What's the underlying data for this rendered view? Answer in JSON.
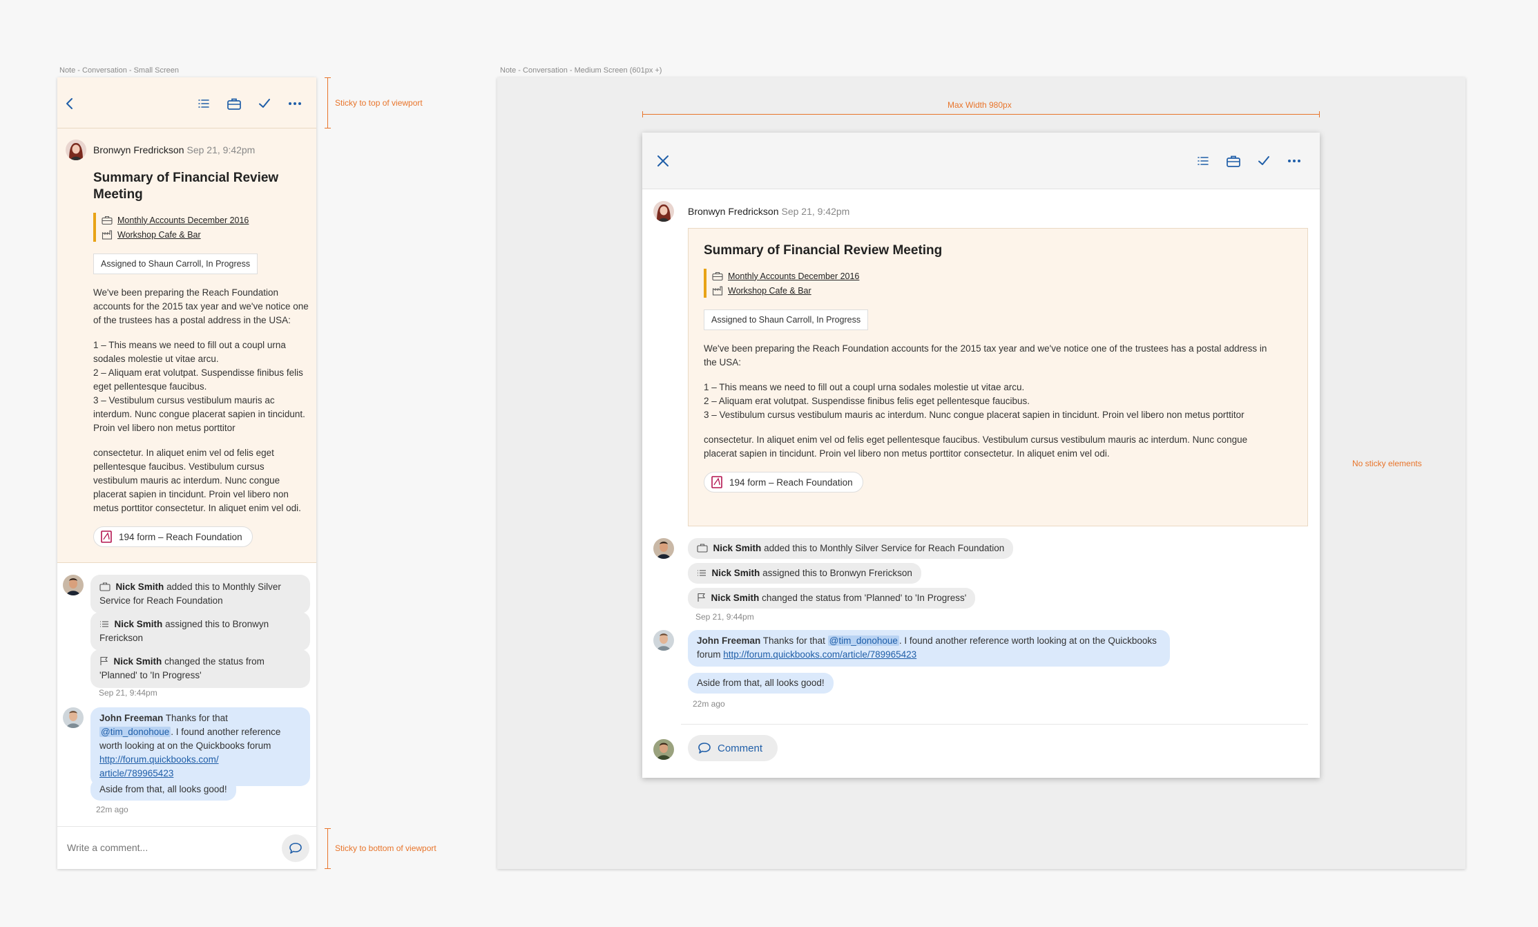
{
  "captions": {
    "small": "Note - Conversation - Small Screen",
    "medium": "Note - Conversation - Medium Screen (601px +)"
  },
  "annotations": {
    "sticky_top": "Sticky to top of viewport",
    "sticky_bottom": "Sticky to bottom of viewport",
    "max_width": "Max Width 980px",
    "no_sticky": "No sticky elements"
  },
  "colors": {
    "accent": "#1f5ea8",
    "note_bg": "#fdf4ea",
    "link_bar": "#e8a317",
    "annotation": "#e8742a",
    "pdf_icon": "#b3134f"
  },
  "toolbar_icons": [
    "back-icon",
    "checklist-icon",
    "briefcase-icon",
    "check-icon",
    "more-icon",
    "close-icon"
  ],
  "note": {
    "author": "Bronwyn Fredrickson",
    "date": "Sep 21, 9:42pm",
    "title": "Summary of Financial Review Meeting",
    "links": [
      {
        "icon": "briefcase-icon",
        "label": "Monthly Accounts December 2016"
      },
      {
        "icon": "store-icon",
        "label": "Workshop Cafe & Bar"
      }
    ],
    "assigned": "Assigned to Shaun Carroll, In Progress",
    "paragraph1": "We've been preparing the Reach Foundation accounts for the 2015 tax year and we've notice one of the trustees has a postal address in the USA:",
    "list": [
      "1 – This means we need to fill out a coupl urna sodales molestie ut vitae arcu.",
      "2 –  Aliquam erat volutpat. Suspendisse finibus felis eget pellentesque faucibus.",
      "3 – Vestibulum cursus vestibulum mauris ac interdum. Nunc congue placerat sapien in tincidunt. Proin vel libero non metus porttitor"
    ],
    "paragraph2": "consectetur. In aliquet enim vel od felis eget pellentesque faucibus. Vestibulum cursus vestibulum mauris ac interdum. Nunc congue placerat sapien in tincidunt. Proin vel libero non metus porttitor consectetur. In aliquet enim vel odi.",
    "attachment": "194 form – Reach Foundation"
  },
  "activity": {
    "actor": "Nick Smith",
    "items": [
      {
        "icon": "briefcase-icon",
        "text": "added this to Monthly Silver Service for Reach Foundation"
      },
      {
        "icon": "checklist-icon",
        "text": "assigned this to Bronwyn Frerickson"
      },
      {
        "icon": "flag-icon",
        "text": "changed the status from 'Planned' to 'In Progress'"
      }
    ],
    "time": "Sep 21, 9:44pm"
  },
  "comment": {
    "author": "John Freeman",
    "pre": "Thanks for that",
    "mention": "@tim_donohoue",
    "post": ". I found another reference worth looking at on the Quickbooks forum",
    "link_small_1": "http://forum.quickbooks.com/",
    "link_small_2": "article/789965423",
    "link": "http://forum.quickbooks.com/article/789965423",
    "followup": "Aside from that, all looks good!",
    "time": "22m ago"
  },
  "composer": {
    "placeholder": "Write a comment...",
    "button_label": "Comment"
  }
}
